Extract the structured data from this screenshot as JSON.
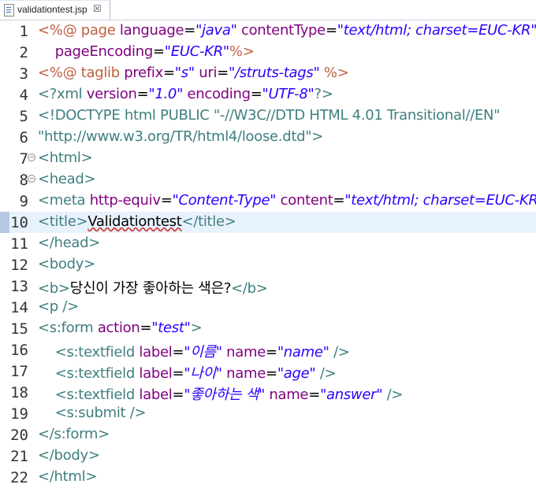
{
  "tab": {
    "title": "validationtest.jsp",
    "close": "☒"
  },
  "lines": [
    {
      "num": "1",
      "fold": false,
      "segs": [
        [
          "dir",
          "<%@ page "
        ],
        [
          "attr",
          "language"
        ],
        [
          "plain",
          "="
        ],
        [
          "val",
          "\"java\""
        ],
        [
          "plain",
          " "
        ],
        [
          "attr",
          "contentType"
        ],
        [
          "plain",
          "="
        ],
        [
          "val",
          "\"text/html; charset=EUC-KR\""
        ]
      ]
    },
    {
      "num": "2",
      "fold": false,
      "segs": [
        [
          "plain",
          "    "
        ],
        [
          "attr",
          "pageEncoding"
        ],
        [
          "plain",
          "="
        ],
        [
          "val",
          "\"EUC-KR\""
        ],
        [
          "dir",
          "%>"
        ]
      ]
    },
    {
      "num": "3",
      "fold": false,
      "segs": [
        [
          "dir",
          "<%@ taglib "
        ],
        [
          "attr",
          "prefix"
        ],
        [
          "plain",
          "="
        ],
        [
          "val",
          "\"s\""
        ],
        [
          "plain",
          " "
        ],
        [
          "attr",
          "uri"
        ],
        [
          "plain",
          "="
        ],
        [
          "val",
          "\"/struts-tags\""
        ],
        [
          "plain",
          " "
        ],
        [
          "dir",
          "%>"
        ]
      ]
    },
    {
      "num": "4",
      "fold": false,
      "segs": [
        [
          "tag",
          "<?xml "
        ],
        [
          "attr",
          "version"
        ],
        [
          "plain",
          "="
        ],
        [
          "val",
          "\"1.0\""
        ],
        [
          "plain",
          " "
        ],
        [
          "attr",
          "encoding"
        ],
        [
          "plain",
          "="
        ],
        [
          "val",
          "\"UTF-8\""
        ],
        [
          "tag",
          "?>"
        ]
      ]
    },
    {
      "num": "5",
      "fold": false,
      "segs": [
        [
          "doc",
          "<!DOCTYPE html PUBLIC \"-//W3C//DTD HTML 4.01 Transitional//EN\""
        ]
      ]
    },
    {
      "num": "6",
      "fold": false,
      "segs": [
        [
          "doc",
          "\"http://www.w3.org/TR/html4/loose.dtd\">"
        ]
      ]
    },
    {
      "num": "7",
      "fold": true,
      "segs": [
        [
          "tag",
          "<html>"
        ]
      ]
    },
    {
      "num": "8",
      "fold": true,
      "segs": [
        [
          "tag",
          "<head>"
        ]
      ]
    },
    {
      "num": "9",
      "fold": false,
      "segs": [
        [
          "tag",
          "<meta "
        ],
        [
          "attr",
          "http-equiv"
        ],
        [
          "plain",
          "="
        ],
        [
          "val",
          "\"Content-Type\""
        ],
        [
          "plain",
          " "
        ],
        [
          "attr",
          "content"
        ],
        [
          "plain",
          "="
        ],
        [
          "val",
          "\"text/html; charset=EUC-KR\""
        ],
        [
          "tag",
          ">"
        ]
      ]
    },
    {
      "num": "10",
      "fold": false,
      "current": true,
      "segs": [
        [
          "tag",
          "<title>"
        ],
        [
          "err",
          "Validationtest"
        ],
        [
          "tag",
          "</title>"
        ]
      ]
    },
    {
      "num": "11",
      "fold": false,
      "segs": [
        [
          "tag",
          "</head>"
        ]
      ]
    },
    {
      "num": "12",
      "fold": false,
      "segs": [
        [
          "tag",
          "<body>"
        ]
      ]
    },
    {
      "num": "13",
      "fold": false,
      "segs": [
        [
          "tag",
          "<b>"
        ],
        [
          "ko",
          "당신이 가장 좋아하는 색은?"
        ],
        [
          "tag",
          "</b>"
        ]
      ]
    },
    {
      "num": "14",
      "fold": false,
      "segs": [
        [
          "tag",
          "<p />"
        ]
      ]
    },
    {
      "num": "15",
      "fold": false,
      "segs": [
        [
          "tag",
          "<s:form "
        ],
        [
          "attr",
          "action"
        ],
        [
          "plain",
          "="
        ],
        [
          "val",
          "\"test\""
        ],
        [
          "tag",
          ">"
        ]
      ]
    },
    {
      "num": "16",
      "fold": false,
      "segs": [
        [
          "plain",
          "    "
        ],
        [
          "tag",
          "<s:textfield "
        ],
        [
          "attr",
          "label"
        ],
        [
          "plain",
          "="
        ],
        [
          "val",
          "\"이름\""
        ],
        [
          "plain",
          " "
        ],
        [
          "attr",
          "name"
        ],
        [
          "plain",
          "="
        ],
        [
          "val",
          "\"name\""
        ],
        [
          "plain",
          " "
        ],
        [
          "tag",
          "/>"
        ]
      ]
    },
    {
      "num": "17",
      "fold": false,
      "segs": [
        [
          "plain",
          "    "
        ],
        [
          "tag",
          "<s:textfield "
        ],
        [
          "attr",
          "label"
        ],
        [
          "plain",
          "="
        ],
        [
          "val",
          "\"나이\""
        ],
        [
          "plain",
          " "
        ],
        [
          "attr",
          "name"
        ],
        [
          "plain",
          "="
        ],
        [
          "val",
          "\"age\""
        ],
        [
          "plain",
          " "
        ],
        [
          "tag",
          "/>"
        ]
      ]
    },
    {
      "num": "18",
      "fold": false,
      "segs": [
        [
          "plain",
          "    "
        ],
        [
          "tag",
          "<s:textfield "
        ],
        [
          "attr",
          "label"
        ],
        [
          "plain",
          "="
        ],
        [
          "val",
          "\"좋아하는 색\""
        ],
        [
          "plain",
          " "
        ],
        [
          "attr",
          "name"
        ],
        [
          "plain",
          "="
        ],
        [
          "val",
          "\"answer\""
        ],
        [
          "plain",
          " "
        ],
        [
          "tag",
          "/>"
        ]
      ]
    },
    {
      "num": "19",
      "fold": false,
      "segs": [
        [
          "plain",
          "    "
        ],
        [
          "tag",
          "<s:submit />"
        ]
      ]
    },
    {
      "num": "20",
      "fold": false,
      "segs": [
        [
          "tag",
          "</s:form>"
        ]
      ]
    },
    {
      "num": "21",
      "fold": false,
      "segs": [
        [
          "tag",
          "</body>"
        ]
      ]
    },
    {
      "num": "22",
      "fold": false,
      "segs": [
        [
          "tag",
          "</html>"
        ]
      ]
    }
  ]
}
